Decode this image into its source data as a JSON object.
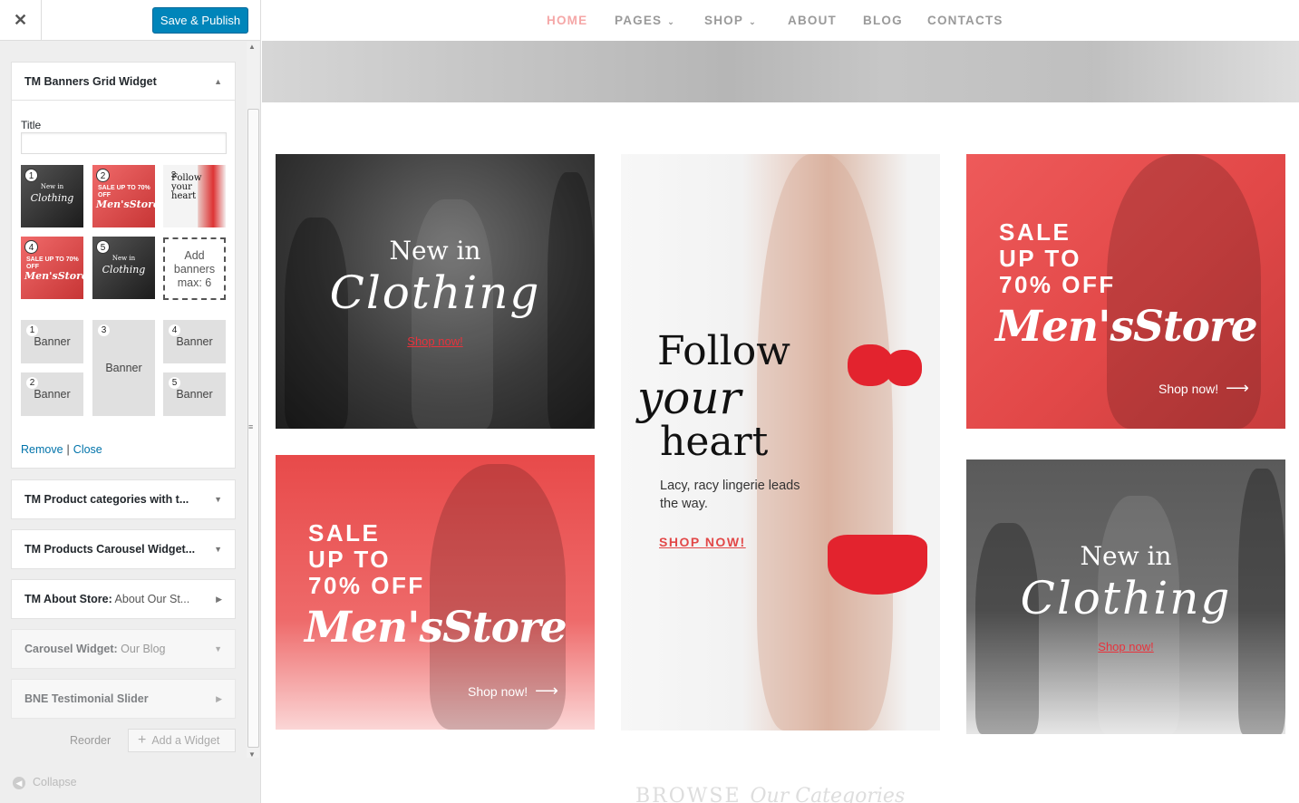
{
  "header": {
    "close_icon": "close-icon",
    "save_label": "Save & Publish"
  },
  "sidebar": {
    "banners_widget": {
      "title": "TM Banners Grid Widget",
      "title_field_label": "Title",
      "title_field_value": "",
      "thumbnails": [
        {
          "num": "1",
          "line1": "New in",
          "line2": "Clothing"
        },
        {
          "num": "2",
          "line1": "SALE UP TO 70% OFF",
          "line2": "Men'sStore"
        },
        {
          "num": "3",
          "line1": "Follow your heart"
        },
        {
          "num": "4",
          "line1": "SALE UP TO 70% OFF",
          "line2": "Men'sStore"
        },
        {
          "num": "5",
          "line1": "New in",
          "line2": "Clothing"
        }
      ],
      "add_banners_label": "Add banners max: 6",
      "layout_slots": [
        {
          "num": "1",
          "label": "Banner"
        },
        {
          "num": "2",
          "label": "Banner"
        },
        {
          "num": "3",
          "label": "Banner"
        },
        {
          "num": "4",
          "label": "Banner"
        },
        {
          "num": "5",
          "label": "Banner"
        }
      ],
      "remove_label": "Remove",
      "separator": "|",
      "close_label": "Close"
    },
    "widgets": [
      {
        "title": "TM Product categories with t...",
        "sub": ""
      },
      {
        "title": "TM Products Carousel Widget...",
        "sub": ""
      },
      {
        "title": "TM About Store:",
        "sub": " About Our St..."
      },
      {
        "title": "Carousel Widget:",
        "sub": " Our Blog"
      },
      {
        "title": "BNE Testimonial Slider",
        "sub": ""
      }
    ],
    "reorder_label": "Reorder",
    "add_widget_label": "Add a Widget",
    "collapse_label": "Collapse"
  },
  "preview": {
    "nav": [
      {
        "label": "HOME",
        "active": true
      },
      {
        "label": "PAGES",
        "dropdown": true
      },
      {
        "label": "SHOP",
        "dropdown": true
      },
      {
        "label": "ABOUT"
      },
      {
        "label": "BLOG"
      },
      {
        "label": "CONTACTS"
      }
    ],
    "banner_new_clothing": {
      "line1": "New in",
      "line2": "Clothing",
      "cta": "Shop now!"
    },
    "banner_follow": {
      "line1": "Follow",
      "line2": "your",
      "line3": "heart",
      "body": "Lacy, racy lingerie leads the way.",
      "cta": "SHOP NOW!"
    },
    "banner_mens": {
      "sale1": "SALE",
      "sale2": "UP TO",
      "sale3": "70% OFF",
      "brand": "Men'sStore",
      "cta": "Shop now!"
    },
    "browse": {
      "main": "BROWSE",
      "italic": "Our Categories"
    }
  },
  "colors": {
    "accent_blue": "#0085ba",
    "link_blue": "#0073aa",
    "brand_red": "#e24848"
  }
}
